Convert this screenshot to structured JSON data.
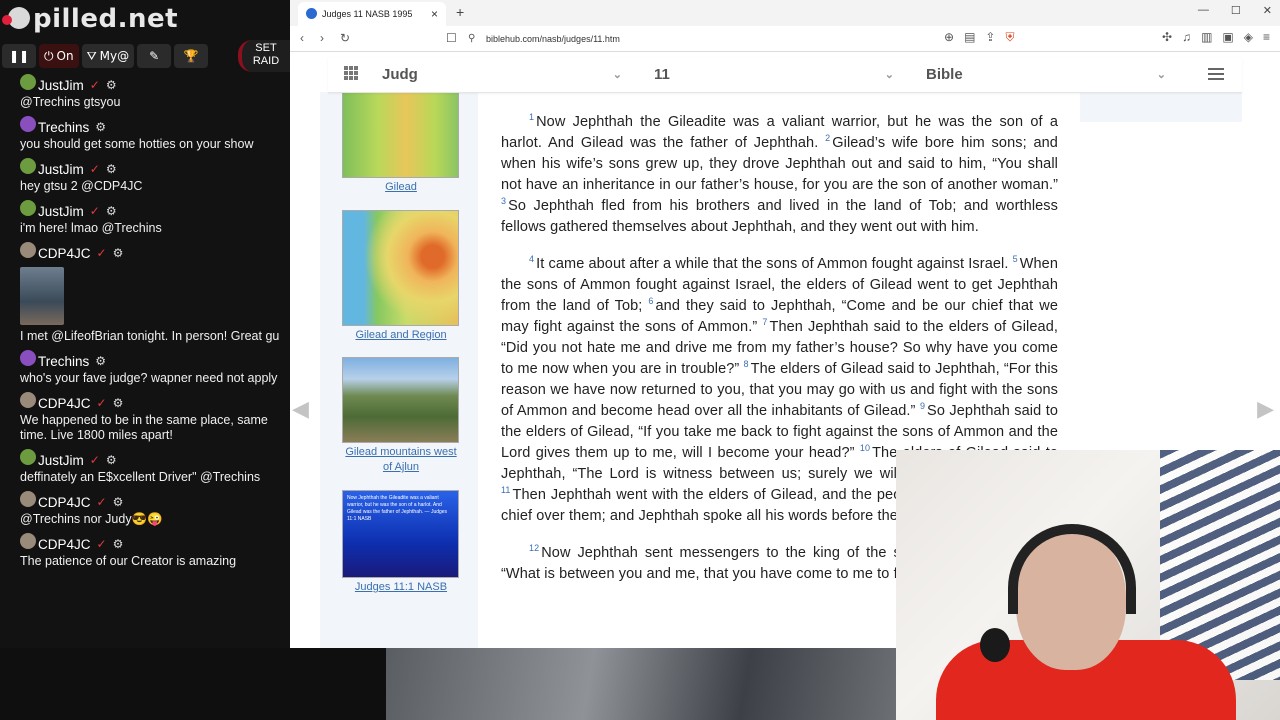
{
  "stream": {
    "brand": "pilled.net",
    "toolbar": {
      "on_label": "On",
      "my_label": "My@",
      "raid_label": "SET RAID"
    },
    "messages": [
      {
        "user": "JustJim",
        "verified": true,
        "text": "@Trechins gtsyou"
      },
      {
        "user": "Trechins",
        "verified": false,
        "text": "you should get some hotties on your show"
      },
      {
        "user": "JustJim",
        "verified": true,
        "text": "hey gtsu 2 @CDP4JC"
      },
      {
        "user": "JustJim",
        "verified": true,
        "text": "i'm here! lmao @Trechins"
      },
      {
        "user": "CDP4JC",
        "verified": true,
        "text": "I met @LifeofBrian tonight. In person! Great gu",
        "has_photo": true
      },
      {
        "user": "Trechins",
        "verified": false,
        "text": "who's your fave judge? wapner need not apply"
      },
      {
        "user": "CDP4JC",
        "verified": true,
        "text": "We happened to be in the same place, same time. Live 1800 miles apart!"
      },
      {
        "user": "JustJim",
        "verified": true,
        "text": "deffinately an E$xcellent Driver\" @Trechins"
      },
      {
        "user": "CDP4JC",
        "verified": true,
        "text": "@Trechins nor Judy😎😜"
      },
      {
        "user": "CDP4JC",
        "verified": true,
        "text": "The patience of our Creator is amazing"
      }
    ]
  },
  "browser": {
    "tab_title": "Judges 11 NASB 1995",
    "url": "biblehub.com/nasb/judges/11.htm"
  },
  "page": {
    "book": "Judg",
    "chapter": "11",
    "version": "Bible",
    "maps": [
      {
        "caption": "Gilead"
      },
      {
        "caption": "Gilead and Region"
      },
      {
        "caption": "Gilead mountains west of Ajlun"
      },
      {
        "caption": "Judges 11:1 NASB"
      }
    ],
    "map4_inner_text": "Now Jephthah the Gileadite was a valiant warrior, but he was the son of a harlot. And Gilead was the father of Jephthah. — Judges 11:1 NASB",
    "paragraphs": [
      {
        "verses": [
          {
            "n": "1",
            "t": "Now Jephthah the Gileadite was a valiant warrior, but he was the son of a harlot. And Gilead was the father of Jephthah."
          },
          {
            "n": "2",
            "t": "Gilead’s wife bore him sons; and when his wife’s sons grew up, they drove Jephthah out and said to him, “You shall not have an inheritance in our father’s house, for you are the son of another woman.”"
          },
          {
            "n": "3",
            "t": "So Jephthah fled from his brothers and lived in the land of Tob; and worthless fellows gathered themselves about Jephthah, and they went out with him."
          }
        ]
      },
      {
        "verses": [
          {
            "n": "4",
            "t": "It came about after a while that the sons of Ammon fought against Israel."
          },
          {
            "n": "5",
            "t": "When the sons of Ammon fought against Israel, the elders of Gilead went to get Jephthah from the land of Tob;"
          },
          {
            "n": "6",
            "t": "and they said to Jephthah, “Come and be our chief that we may fight against the sons of Ammon.”"
          },
          {
            "n": "7",
            "t": "Then Jephthah said to the elders of Gilead, “Did you not hate me and drive me from my father’s house? So why have you come to me now when you are in trouble?”"
          },
          {
            "n": "8",
            "t": "The elders of Gilead said to Jephthah, “For this reason we have now returned to you, that you may go with us and fight with the sons of Ammon and become head over all the inhabitants of Gilead.”"
          },
          {
            "n": "9",
            "t": "So Jephthah said to the elders of Gilead, “If you take me back to fight against the sons of Ammon and the Lord gives them up to me, will I become your head?”"
          },
          {
            "n": "10",
            "t": "The elders of Gilead said to Jephthah, “The Lord is witness between us; surely we will do as you have said.”"
          },
          {
            "n": "11",
            "t": "Then Jephthah went with the elders of Gilead, and the people made him head and chief over them; and Jephthah spoke all his words before the Lord at Mizpah."
          }
        ]
      },
      {
        "verses": [
          {
            "n": "12",
            "t": "Now Jephthah sent messengers to the king of the sons of Ammon, saying, “What is between you and me, that you have come to me to fight against my land?”"
          }
        ]
      }
    ]
  }
}
